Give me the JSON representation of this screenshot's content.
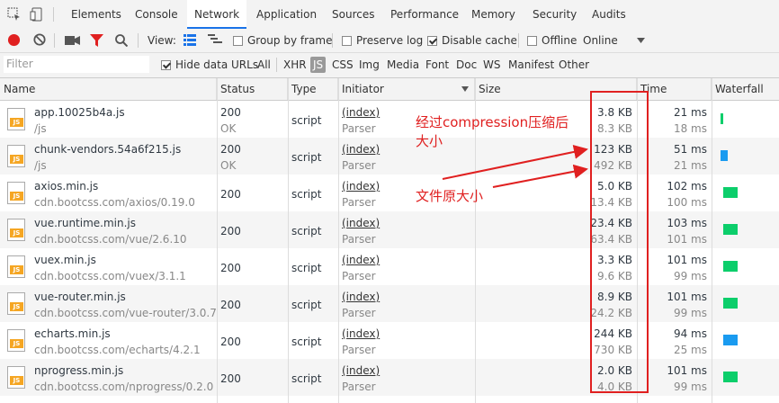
{
  "devtools_tabs": [
    "Elements",
    "Console",
    "Network",
    "Application",
    "Sources",
    "Performance",
    "Memory",
    "Security",
    "Audits"
  ],
  "active_tab": "Network",
  "toolbar": {
    "view_label": "View:",
    "group_by_frame": "Group by frame",
    "preserve_log": "Preserve log",
    "disable_cache": "Disable cache",
    "offline": "Offline",
    "throttle": "Online"
  },
  "filterbar": {
    "placeholder": "Filter",
    "hide_data_urls": "Hide data URLs",
    "types": [
      "All",
      "XHR",
      "JS",
      "CSS",
      "Img",
      "Media",
      "Font",
      "Doc",
      "WS",
      "Manifest",
      "Other"
    ],
    "active_type": "JS"
  },
  "columns": {
    "name": "Name",
    "status": "Status",
    "type": "Type",
    "initiator": "Initiator",
    "size": "Size",
    "time": "Time",
    "waterfall": "Waterfall"
  },
  "rows": [
    {
      "name": "app.10025b4a.js",
      "path": "/js",
      "status": "200",
      "status_text": "OK",
      "type": "script",
      "initiator": "(index)",
      "initiator_sub": "Parser",
      "size": "3.8 KB",
      "content_size": "8.3 KB",
      "time": "21 ms",
      "latency": "18 ms"
    },
    {
      "name": "chunk-vendors.54a6f215.js",
      "path": "/js",
      "status": "200",
      "status_text": "OK",
      "type": "script",
      "initiator": "(index)",
      "initiator_sub": "Parser",
      "size": "123 KB",
      "content_size": "492 KB",
      "time": "51 ms",
      "latency": "21 ms"
    },
    {
      "name": "axios.min.js",
      "path": "cdn.bootcss.com/axios/0.19.0",
      "status": "200",
      "status_text": "",
      "type": "script",
      "initiator": "(index)",
      "initiator_sub": "Parser",
      "size": "5.0 KB",
      "content_size": "13.4 KB",
      "time": "102 ms",
      "latency": "100 ms"
    },
    {
      "name": "vue.runtime.min.js",
      "path": "cdn.bootcss.com/vue/2.6.10",
      "status": "200",
      "status_text": "",
      "type": "script",
      "initiator": "(index)",
      "initiator_sub": "Parser",
      "size": "23.4 KB",
      "content_size": "63.4 KB",
      "time": "103 ms",
      "latency": "101 ms"
    },
    {
      "name": "vuex.min.js",
      "path": "cdn.bootcss.com/vuex/3.1.1",
      "status": "200",
      "status_text": "",
      "type": "script",
      "initiator": "(index)",
      "initiator_sub": "Parser",
      "size": "3.3 KB",
      "content_size": "9.6 KB",
      "time": "101 ms",
      "latency": "99 ms"
    },
    {
      "name": "vue-router.min.js",
      "path": "cdn.bootcss.com/vue-router/3.0.7",
      "status": "200",
      "status_text": "",
      "type": "script",
      "initiator": "(index)",
      "initiator_sub": "Parser",
      "size": "8.9 KB",
      "content_size": "24.2 KB",
      "time": "101 ms",
      "latency": "99 ms"
    },
    {
      "name": "echarts.min.js",
      "path": "cdn.bootcss.com/echarts/4.2.1",
      "status": "200",
      "status_text": "",
      "type": "script",
      "initiator": "(index)",
      "initiator_sub": "Parser",
      "size": "244 KB",
      "content_size": "730 KB",
      "time": "94 ms",
      "latency": "25 ms"
    },
    {
      "name": "nprogress.min.js",
      "path": "cdn.bootcss.com/nprogress/0.2.0",
      "status": "200",
      "status_text": "",
      "type": "script",
      "initiator": "(index)",
      "initiator_sub": "Parser",
      "size": "2.0 KB",
      "content_size": "4.0 KB",
      "time": "101 ms",
      "latency": "99 ms"
    }
  ],
  "annotations": {
    "compressed_line1": "经过compression压缩后",
    "compressed_line2": "大小",
    "original": "文件原大小"
  },
  "colors": {
    "accent": "#1a73e8",
    "annotation": "#e02020",
    "waterfall_green": "#0cce6b",
    "waterfall_blue": "#1a9bf0"
  }
}
